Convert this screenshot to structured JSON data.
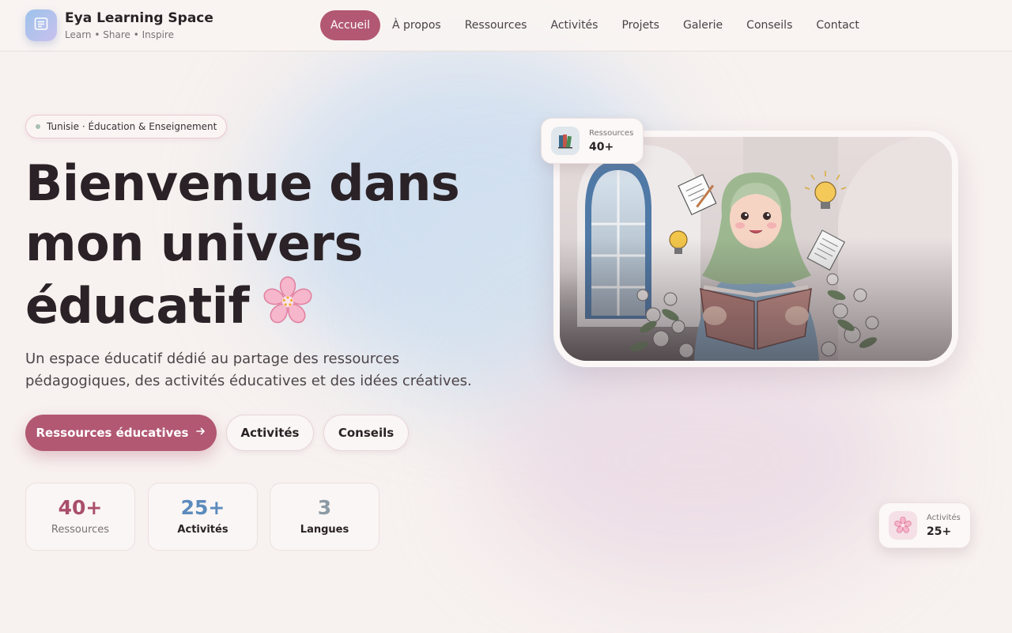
{
  "header": {
    "brand_name": "Eya Learning Space",
    "brand_tagline": "Learn • Share • Inspire",
    "logo_icon": "book-icon",
    "nav": [
      {
        "label": "Accueil",
        "active": true
      },
      {
        "label": "À propos",
        "active": false
      },
      {
        "label": "Ressources",
        "active": false
      },
      {
        "label": "Activités",
        "active": false
      },
      {
        "label": "Projets",
        "active": false
      },
      {
        "label": "Galerie",
        "active": false
      },
      {
        "label": "Conseils",
        "active": false
      },
      {
        "label": "Contact",
        "active": false
      }
    ]
  },
  "hero": {
    "badge": "Tunisie · Éducation & Enseignement",
    "title_lines": [
      "Bienvenue dans",
      "mon univers",
      "éducatif"
    ],
    "title_icon": "cherry-blossom-icon",
    "subtitle_lines": [
      "Un espace éducatif dédié au partage des ressources",
      "pédagogiques, des activités éducatives et des idées créatives."
    ],
    "buttons": {
      "primary": "Ressources éducatives",
      "primary_icon": "arrow-right-icon",
      "activities": "Activités",
      "advice": "Conseils"
    },
    "stats": [
      {
        "value": "40+",
        "label": "Ressources"
      },
      {
        "value": "25+",
        "label": "Activités"
      },
      {
        "value": "3",
        "label": "Langues"
      }
    ]
  },
  "floating_cards": [
    {
      "label": "Ressources",
      "value": "40+",
      "icon": "books-icon"
    },
    {
      "label": "Activités",
      "value": "25+",
      "icon": "cherry-blossom-icon"
    }
  ],
  "colors": {
    "accent": "#b25873",
    "blue": "#5b8bbd",
    "gray": "#8c9aa5",
    "background": "#f7f1ef"
  }
}
